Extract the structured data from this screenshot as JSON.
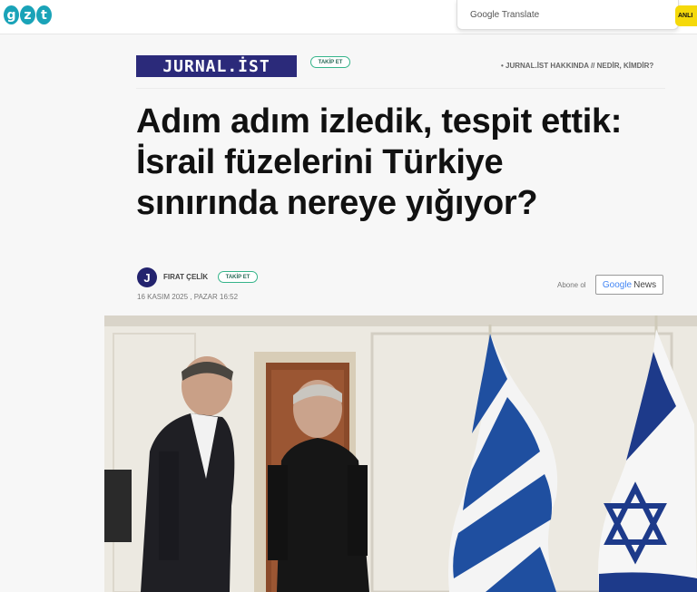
{
  "top": {
    "logo_letters": [
      "g",
      "z",
      "t"
    ],
    "translate_label": "Google Translate",
    "yellow_button": "ANLI"
  },
  "header": {
    "brand": "JURNAL.İST",
    "follow_label": "TAKİP ET",
    "links": "• JURNAL.İST HAKKINDA // NEDİR, KİMDİR?"
  },
  "article": {
    "headline": "Adım adım izledik, tespit ettik: İsrail füzelerini Türkiye sınırında nereye yığıyor?",
    "author": {
      "initial": "J",
      "name": "FIRAT ÇELİK",
      "follow_label": "TAKİP ET"
    },
    "date": "16 KASIM 2025 , PAZAR 16:52",
    "subscribe_label": "Abone ol",
    "gnews_google": "Google",
    "gnews_news": "News"
  },
  "colors": {
    "brand": "#2b2a7a",
    "accent_green": "#35b48a",
    "logo": "#1aa3b8",
    "yellow": "#f5d90a",
    "greek_blue": "#1f4fa0",
    "israel_blue": "#1d3a8a"
  }
}
